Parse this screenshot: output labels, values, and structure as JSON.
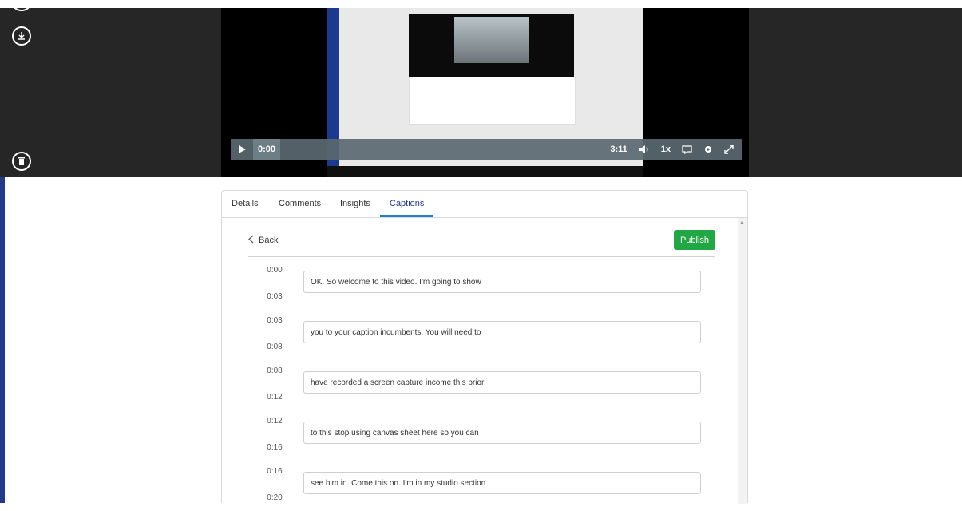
{
  "player": {
    "current_time": "0:00",
    "duration": "3:11",
    "speed": "1x",
    "icons": [
      "download-icon",
      "delete-icon",
      "play-icon",
      "volume-icon",
      "caption-icon",
      "settings-icon",
      "fullscreen-icon"
    ]
  },
  "tabs": [
    {
      "label": "Details"
    },
    {
      "label": "Comments"
    },
    {
      "label": "Insights"
    },
    {
      "label": "Captions"
    }
  ],
  "captions_editor": {
    "back_label": "Back",
    "publish_label": "Publish",
    "rows": [
      {
        "start": "0:00",
        "end": "0:03",
        "text": "OK. So welcome to this video. I'm going to show"
      },
      {
        "start": "0:03",
        "end": "0:08",
        "text": "you to your caption incumbents. You will need to"
      },
      {
        "start": "0:08",
        "end": "0:12",
        "text": "have recorded a screen capture income this prior"
      },
      {
        "start": "0:12",
        "end": "0:16",
        "text": "to this stop using canvas sheet here so you can"
      },
      {
        "start": "0:16",
        "end": "0:20",
        "text": "see him in. Come this on. I'm in my studio section"
      }
    ]
  },
  "colors": {
    "publish": "#21a845",
    "active_tab_underline": "#1e7fcf",
    "dark_bg": "#262626"
  }
}
